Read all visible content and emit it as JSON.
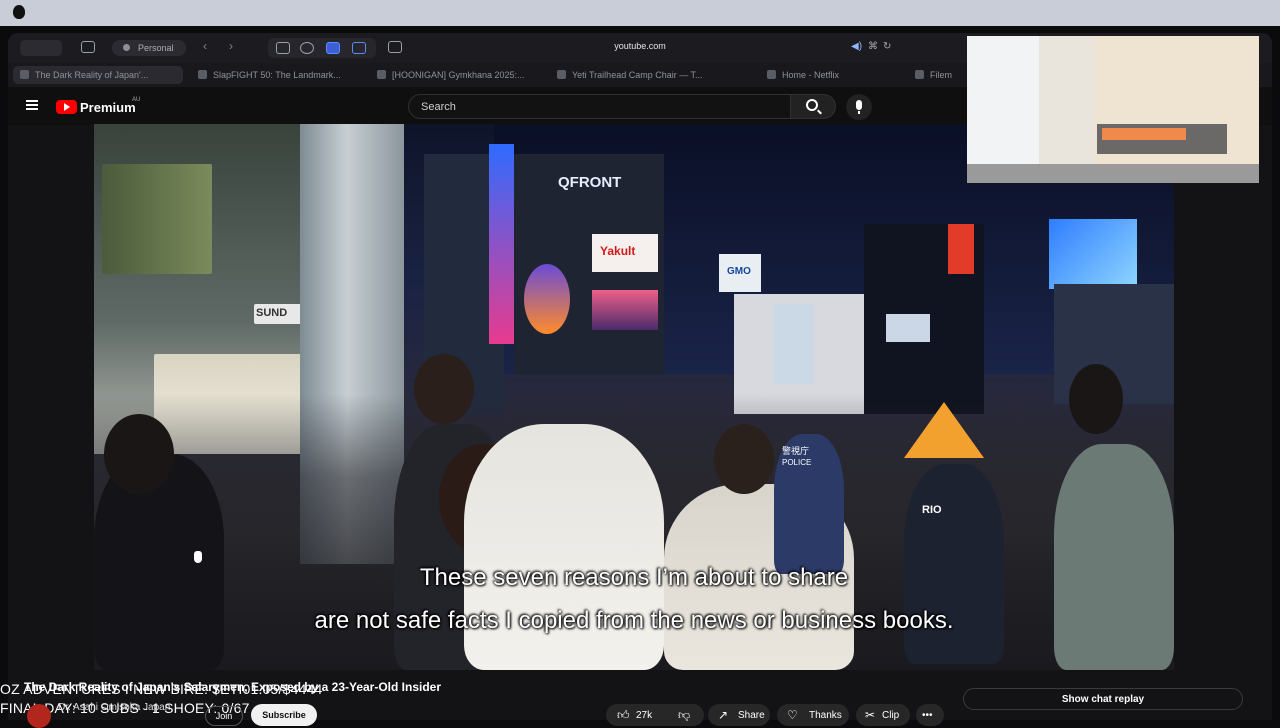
{
  "browser": {
    "profile_label": "Personal",
    "url": "youtube.com",
    "tabs": [
      {
        "label": "The Dark Reality of Japan'...",
        "active": true
      },
      {
        "label": "SlapFIGHT 50: The Landmark..."
      },
      {
        "label": "[HOONIGAN] Gymkhana 2025:..."
      },
      {
        "label": "Yeti Trailhead Camp Chair — T..."
      },
      {
        "label": "Home - Netflix"
      },
      {
        "label": "Filem"
      }
    ]
  },
  "youtube": {
    "brand": "Premium",
    "region": "AU",
    "search_placeholder": "Search"
  },
  "video": {
    "subtitle_line1": "These seven reasons I’m about to share",
    "subtitle_line2": "are not safe facts I copied from the news or business books.",
    "scene_signs": {
      "qfront": "QFRONT",
      "yakult": "Yakult",
      "gmo": "GMO",
      "sunday": "SUND",
      "police": "POLICE",
      "keishicho": "警視庁",
      "rio": "RIO"
    },
    "title": "The Dark Reality of Japan's Salarymen, Exposed by a 23-Year-Old Insider"
  },
  "overlay": {
    "line1": "OZ ADVENTURES I NEW BIRE: $ETI01.05/$4444",
    "line2": "FINAL DAY: 10 SUBS - 1 SHOEY: 0/67"
  },
  "channel": {
    "name": "Dr. Asahi Omisoka Japan",
    "join_label": "Join",
    "subscribe_label": "Subscribe"
  },
  "actions": {
    "likes": "27k",
    "share": "Share",
    "thanks": "Thanks",
    "clip": "Clip",
    "more": "•••"
  },
  "chat": {
    "show_replay": "Show chat replay"
  }
}
